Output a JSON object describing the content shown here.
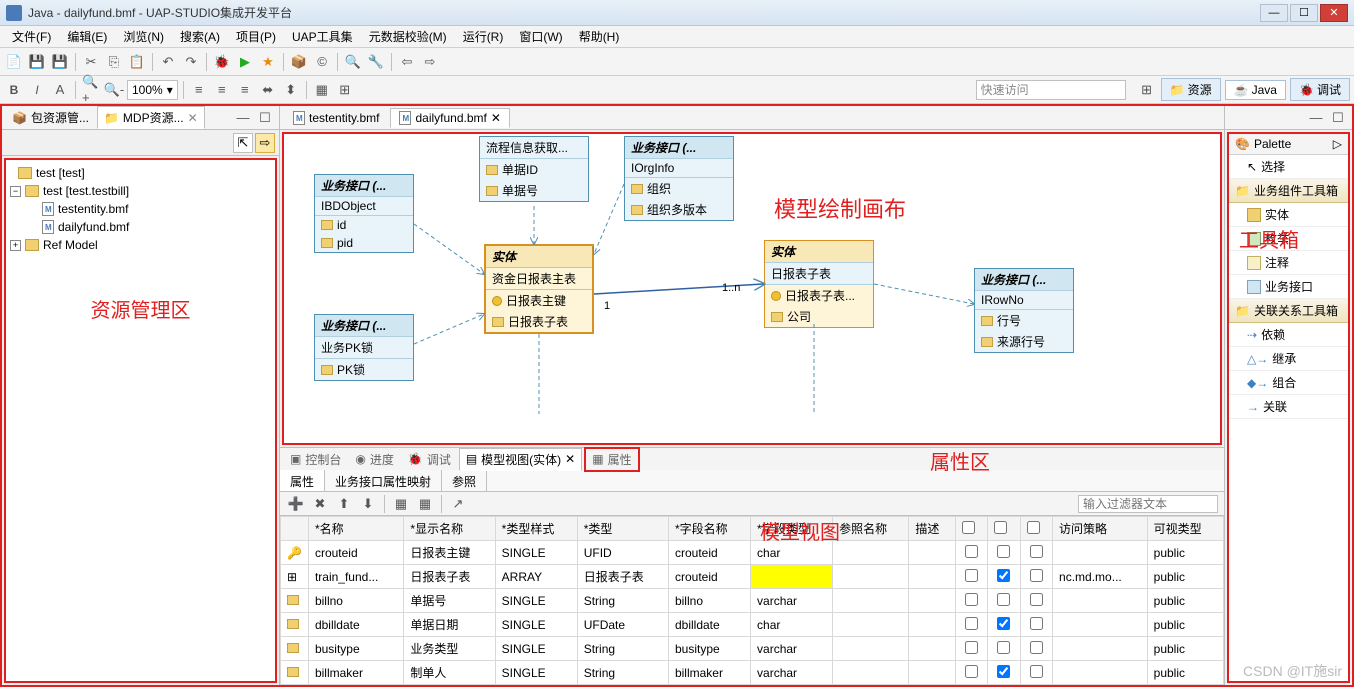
{
  "window": {
    "title": "Java - dailyfund.bmf - UAP-STUDIO集成开发平台",
    "min": "—",
    "max": "☐",
    "close": "✕"
  },
  "menus": [
    "文件(F)",
    "编辑(E)",
    "浏览(N)",
    "搜索(A)",
    "项目(P)",
    "UAP工具集",
    "元数据校验(M)",
    "运行(R)",
    "窗口(W)",
    "帮助(H)"
  ],
  "toolbar": {
    "zoom": "100%"
  },
  "quick_access": "快速访问",
  "perspectives": {
    "resource": "资源",
    "java": "Java",
    "debug": "调试"
  },
  "left_views": {
    "tab1": "包资源管...",
    "tab2": "MDP资源...",
    "close": "✕"
  },
  "tree": {
    "root1": "test [test]",
    "root2": "test [test.testbill]",
    "file1": "testentity.bmf",
    "file2": "dailyfund.bmf",
    "refmodel": "Ref Model"
  },
  "left_label": "资源管理区",
  "editor_tabs": {
    "tab1": "testentity.bmf",
    "tab2": "dailyfund.bmf"
  },
  "canvas_label": "模型绘制画布",
  "models": {
    "ibdobject": {
      "title": "业务接口 (...",
      "name": "IBDObject",
      "rows": [
        "id",
        "pid"
      ]
    },
    "flow": {
      "title": "",
      "name": "流程信息获取...",
      "rows": [
        "单据ID",
        "单据号"
      ]
    },
    "iorginfo": {
      "title": "业务接口 (...",
      "name": "IOrgInfo",
      "rows": [
        "组织",
        "组织多版本"
      ]
    },
    "pklock": {
      "title": "业务接口 (...",
      "name": "业务PK锁",
      "rows": [
        "PK锁"
      ]
    },
    "entity_main": {
      "title": "实体",
      "name": "资金日报表主表",
      "rows": [
        "日报表主键",
        "日报表子表"
      ]
    },
    "entity_child": {
      "title": "实体",
      "name": "日报表子表",
      "rows": [
        "日报表子表...",
        "公司"
      ]
    },
    "irowno": {
      "title": "业务接口 (...",
      "name": "IRowNo",
      "rows": [
        "行号",
        "来源行号"
      ]
    },
    "rel_label": "1..n",
    "rel_one": "1"
  },
  "right_label": "工具箱",
  "palette": {
    "header": "Palette",
    "select": "选择",
    "drawer1": "业务组件工具箱",
    "items1": [
      "实体",
      "枚举",
      "注释",
      "业务接口"
    ],
    "drawer2": "关联关系工具箱",
    "items2": [
      "依赖",
      "继承",
      "组合",
      "关联"
    ]
  },
  "bottom_tabs": {
    "console": "控制台",
    "progress": "进度",
    "debug": "调试",
    "modelview": "模型视图(实体)",
    "props": "属性"
  },
  "bottom_label": "属性区",
  "mid_label": "模型视图",
  "prop_tabs": {
    "attrs": "属性",
    "mapping": "业务接口属性映射",
    "ref": "参照"
  },
  "filter_placeholder": "输入过滤器文本",
  "columns": [
    "*名称",
    "*显示名称",
    "*类型样式",
    "*类型",
    "*字段名称",
    "*字段类型",
    "参照名称",
    "描述",
    "",
    "",
    "",
    "访问策略",
    "可视类型"
  ],
  "rows": [
    {
      "ico": "key",
      "name": "crouteid",
      "disp": "日报表主键",
      "style": "SINGLE",
      "type": "UFID",
      "field": "crouteid",
      "ftype": "char",
      "ref": "",
      "desc": "",
      "c1": false,
      "c2": false,
      "c3": false,
      "access": "",
      "vis": "public"
    },
    {
      "ico": "arr",
      "name": "train_fund...",
      "disp": "日报表子表",
      "style": "ARRAY",
      "type": "日报表子表",
      "field": "crouteid",
      "ftype": "",
      "ref": "",
      "desc": "",
      "c1": false,
      "c2": true,
      "c3": false,
      "access": "nc.md.mo...",
      "vis": "public"
    },
    {
      "ico": "p",
      "name": "billno",
      "disp": "单据号",
      "style": "SINGLE",
      "type": "String",
      "field": "billno",
      "ftype": "varchar",
      "ref": "",
      "desc": "",
      "c1": false,
      "c2": false,
      "c3": false,
      "access": "",
      "vis": "public"
    },
    {
      "ico": "p",
      "name": "dbilldate",
      "disp": "单据日期",
      "style": "SINGLE",
      "type": "UFDate",
      "field": "dbilldate",
      "ftype": "char",
      "ref": "",
      "desc": "",
      "c1": false,
      "c2": true,
      "c3": false,
      "access": "",
      "vis": "public"
    },
    {
      "ico": "p",
      "name": "busitype",
      "disp": "业务类型",
      "style": "SINGLE",
      "type": "String",
      "field": "busitype",
      "ftype": "varchar",
      "ref": "",
      "desc": "",
      "c1": false,
      "c2": false,
      "c3": false,
      "access": "",
      "vis": "public"
    },
    {
      "ico": "p",
      "name": "billmaker",
      "disp": "制单人",
      "style": "SINGLE",
      "type": "String",
      "field": "billmaker",
      "ftype": "varchar",
      "ref": "",
      "desc": "",
      "c1": false,
      "c2": true,
      "c3": false,
      "access": "",
      "vis": "public"
    }
  ],
  "watermark": "CSDN @IT施sir"
}
